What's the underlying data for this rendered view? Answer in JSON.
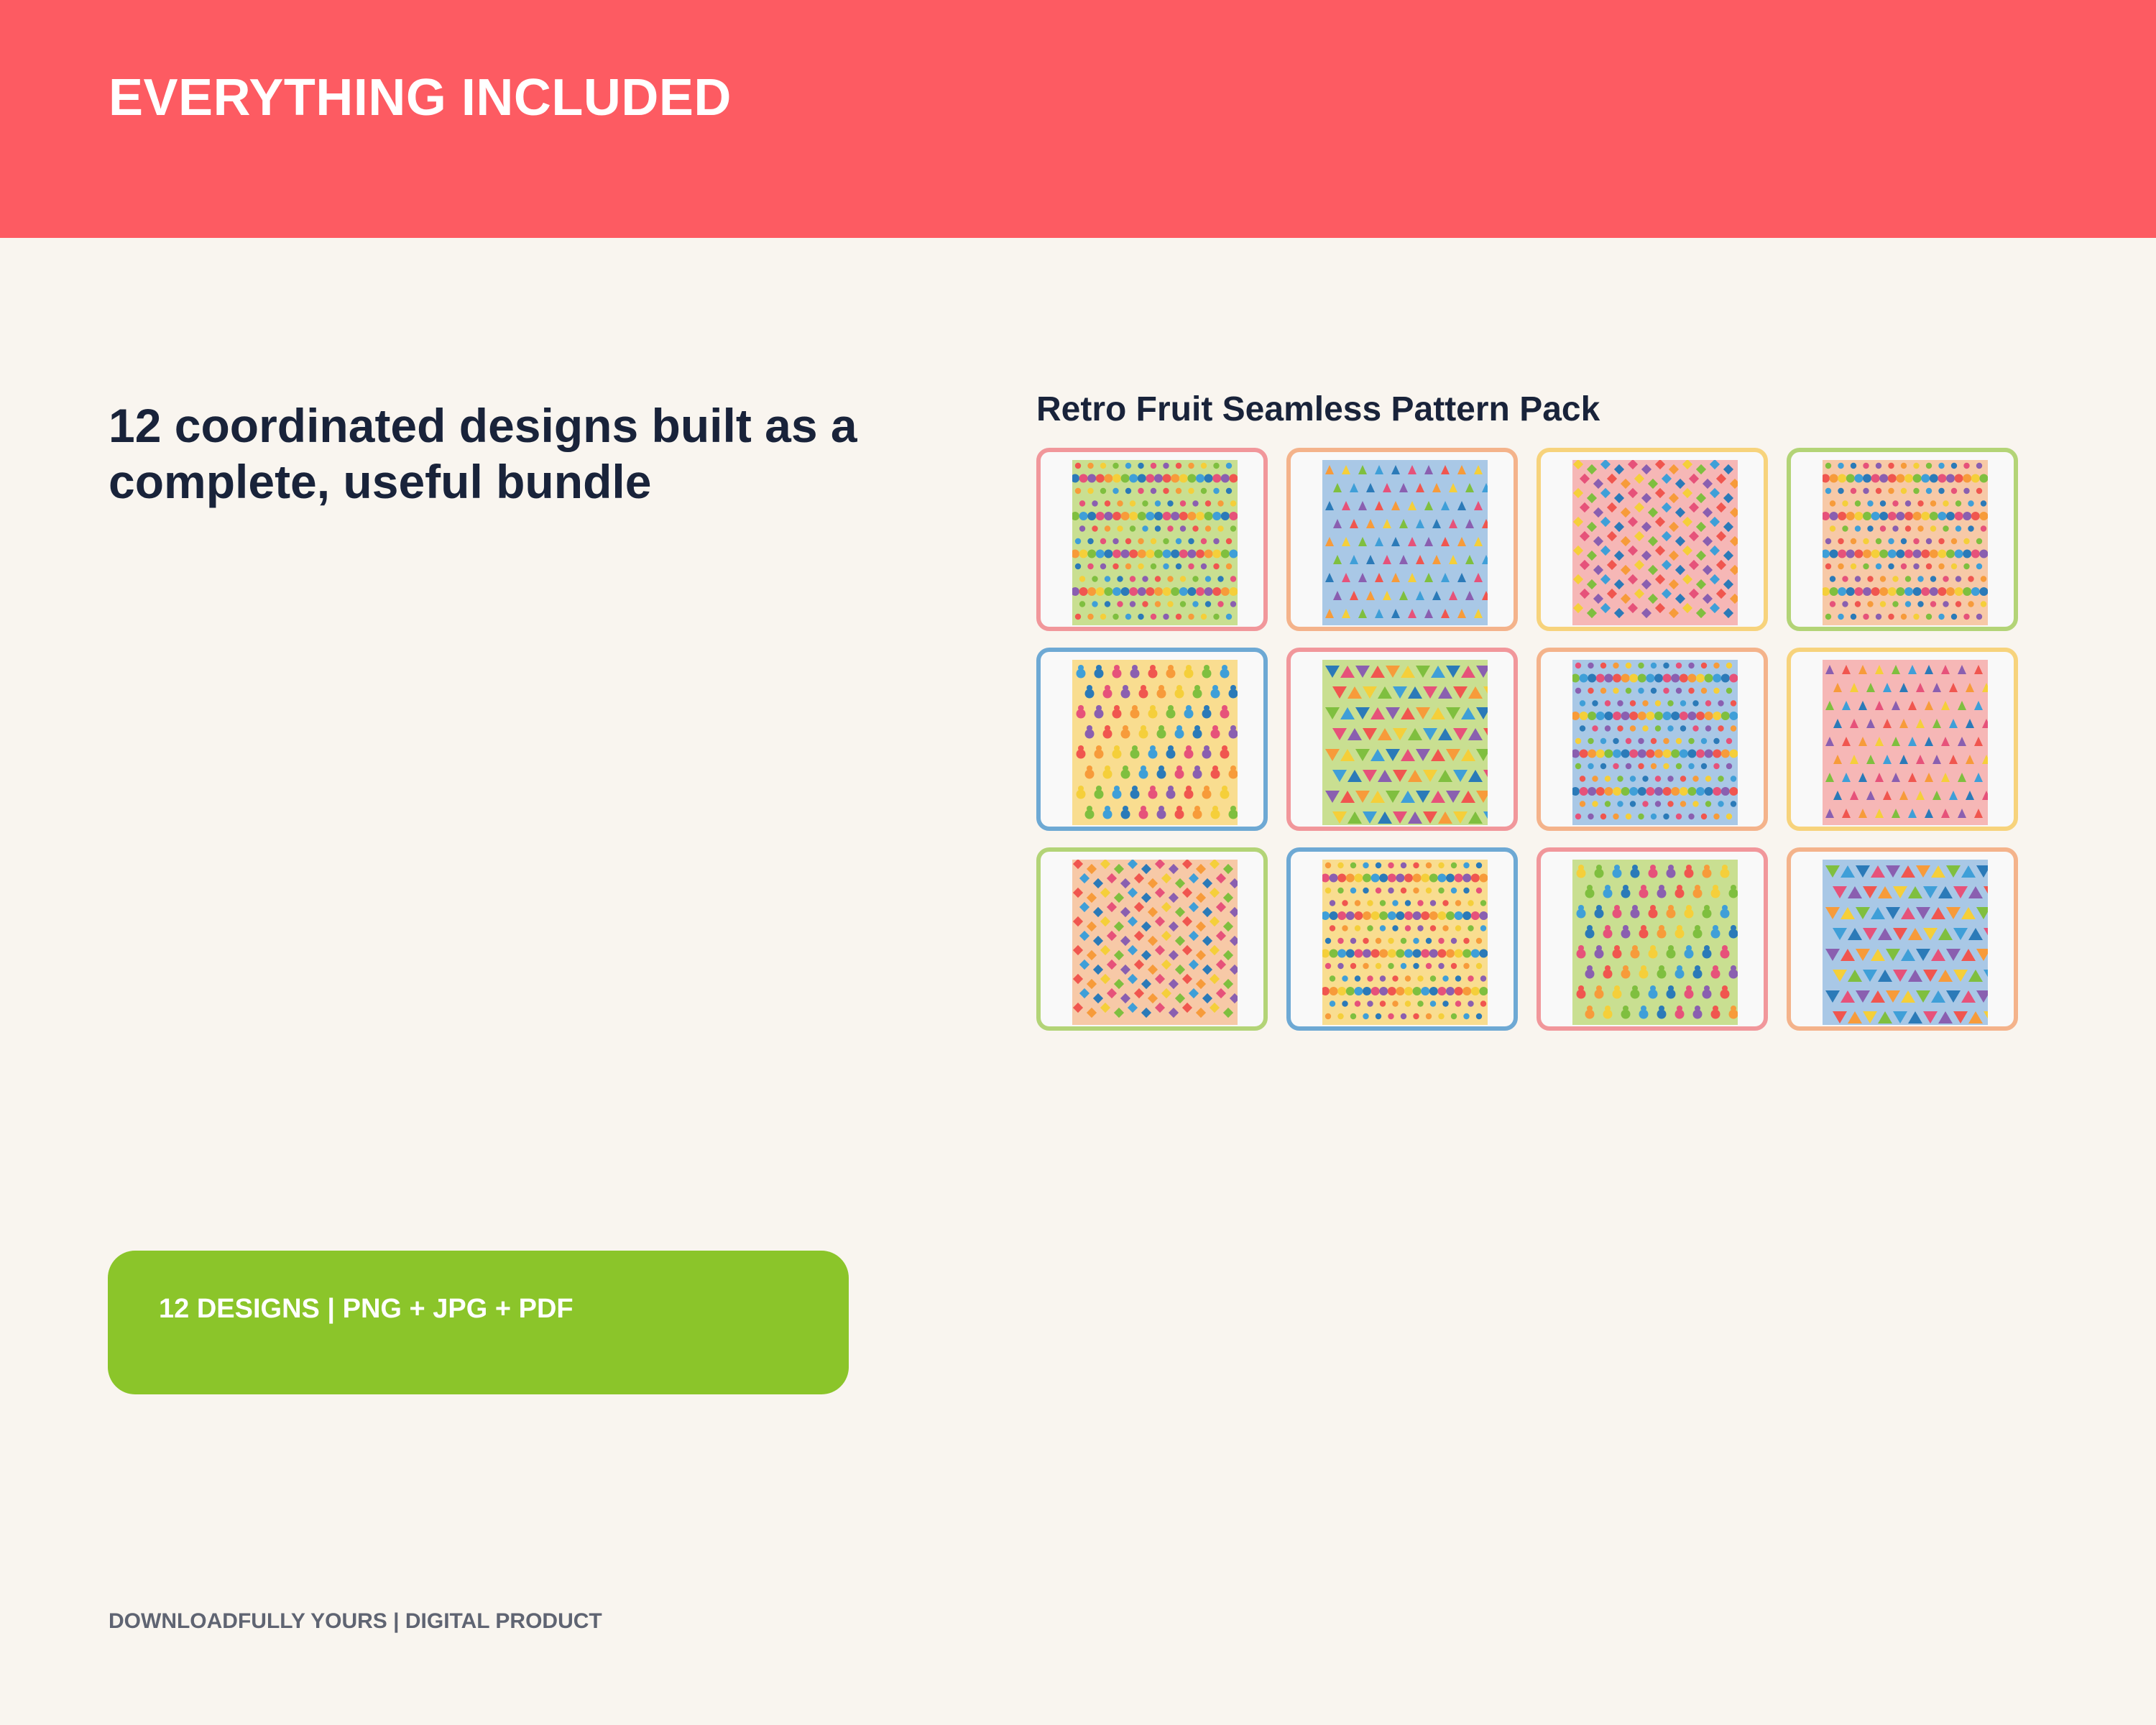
{
  "header": {
    "title": "EVERYTHING INCLUDED",
    "background": "#fd5b62"
  },
  "headline": "12 coordinated designs built as a complete, useful bundle",
  "gallery": {
    "title": "Retro Fruit Seamless Pattern Pack",
    "designs": [
      {
        "motif": "dots",
        "bg": "#c9df91",
        "border": "#f1979b"
      },
      {
        "motif": "cherries",
        "bg": "#a9c8e6",
        "border": "#f4b38b"
      },
      {
        "motif": "diamonds",
        "bg": "#f6b7b6",
        "border": "#f7d37c"
      },
      {
        "motif": "dots",
        "bg": "#f7c9a7",
        "border": "#b3d477"
      },
      {
        "motif": "pears",
        "bg": "#f9dd90",
        "border": "#6ea9d4"
      },
      {
        "motif": "triangles",
        "bg": "#c9df91",
        "border": "#f1979b"
      },
      {
        "motif": "dots",
        "bg": "#a9c8e6",
        "border": "#f4b38b"
      },
      {
        "motif": "cherries",
        "bg": "#f6b7b6",
        "border": "#f7d37c"
      },
      {
        "motif": "diamonds",
        "bg": "#f7c9a7",
        "border": "#b3d477"
      },
      {
        "motif": "dots",
        "bg": "#f9dd90",
        "border": "#6ea9d4"
      },
      {
        "motif": "pears",
        "bg": "#c9df91",
        "border": "#f1979b"
      },
      {
        "motif": "triangles",
        "bg": "#a9c8e6",
        "border": "#f4b38b"
      }
    ],
    "motif_colors": [
      "#f0564f",
      "#f79b3a",
      "#f5cf3a",
      "#7fbf3f",
      "#3f9fd8",
      "#2b7ab8",
      "#e6527a",
      "#8a5fb0"
    ]
  },
  "badge": {
    "text": "12 DESIGNS | PNG + JPG + PDF",
    "background": "#8bc52a"
  },
  "footer": "DOWNLOADFULLY YOURS | DIGITAL PRODUCT"
}
